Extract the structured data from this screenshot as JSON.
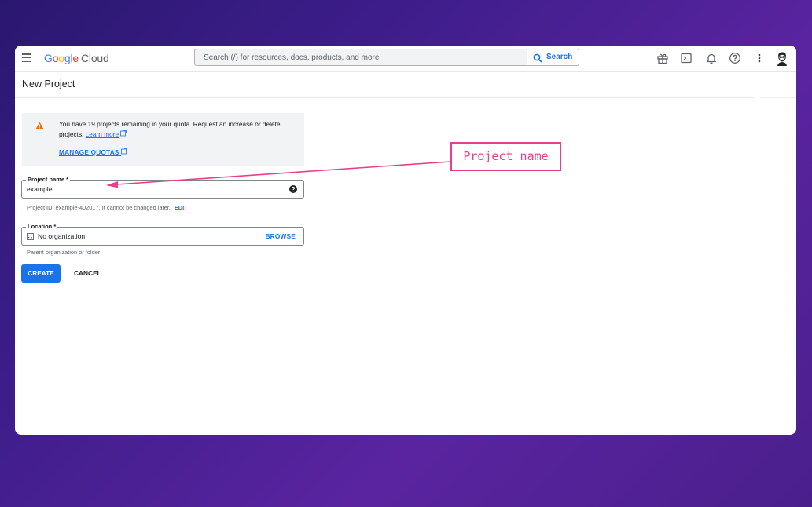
{
  "header": {
    "logo_google": [
      "G",
      "o",
      "o",
      "g",
      "l",
      "e"
    ],
    "logo_cloud": "Cloud",
    "search_placeholder": "Search (/) for resources, docs, products, and more",
    "search_button": "Search",
    "icons": [
      "gift-icon",
      "terminal-icon",
      "bell-icon",
      "help-icon",
      "more-vert-icon",
      "avatar"
    ]
  },
  "page": {
    "title": "New Project"
  },
  "quota_notice": {
    "text": "You have 19 projects remaining in your quota. Request an increase or delete projects.",
    "learn_more": "Learn more",
    "manage_quotas": "MANAGE QUOTAS"
  },
  "project_name": {
    "label": "Project name *",
    "value": "example",
    "helper": "Project ID: example-402017. It cannot be changed later.",
    "edit": "EDIT"
  },
  "location": {
    "label": "Location *",
    "value": "No organization",
    "browse": "BROWSE",
    "helper": "Parent organization or folder"
  },
  "actions": {
    "create": "CREATE",
    "cancel": "CANCEL"
  },
  "annotation": {
    "label": "Project name"
  },
  "colors": {
    "accent": "#1a73e8",
    "annotation": "#e83e8c",
    "warning": "#e8710a"
  }
}
